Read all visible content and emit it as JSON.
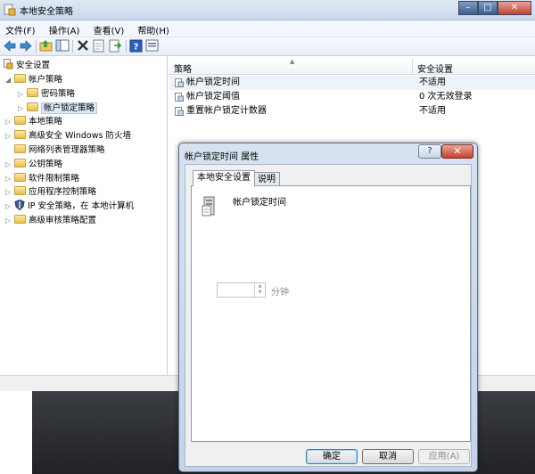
{
  "window": {
    "title": "本地安全策略",
    "minimize": "–",
    "maximize": "□",
    "close": "✕"
  },
  "menu": [
    "文件(F)",
    "操作(A)",
    "查看(V)",
    "帮助(H)"
  ],
  "toolbar": [
    "back-icon",
    "forward-icon",
    "up-folder-icon",
    "show-hide-tree-icon",
    "delete-icon",
    "properties-icon",
    "export-icon",
    "help-icon",
    "console-icon"
  ],
  "tree": {
    "root": "安全设置",
    "account_policy": "帐户策略",
    "password_policy": "密码策略",
    "lockout_policy": "帐户锁定策略",
    "local_policy": "本地策略",
    "firewall": "高级安全 Windows 防火墙",
    "network_list": "网络列表管理器策略",
    "public_key": "公钥策略",
    "software_restriction": "软件限制策略",
    "app_control": "应用程序控制策略",
    "ipsec": "IP 安全策略，在 本地计算机",
    "audit": "高级审核策略配置"
  },
  "list": {
    "col_policy": "策略",
    "col_setting": "安全设置",
    "rows": [
      {
        "name": "帐户锁定时间",
        "value": "不适用"
      },
      {
        "name": "帐户锁定阈值",
        "value": "0 次无效登录"
      },
      {
        "name": "重置帐户锁定计数器",
        "value": "不适用"
      }
    ]
  },
  "dialog": {
    "title": "帐户锁定时间 属性",
    "help": "?",
    "close": "✕",
    "tab_local": "本地安全设置",
    "tab_explain": "说明",
    "policy_name": "帐户锁定时间",
    "unit": "分钟",
    "ok": "确定",
    "cancel": "取消",
    "apply": "应用(A)"
  }
}
